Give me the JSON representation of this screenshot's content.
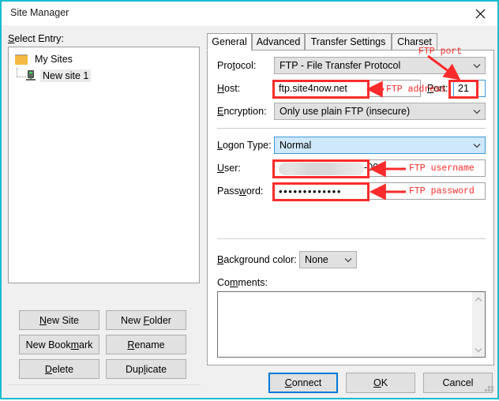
{
  "window": {
    "title": "Site Manager",
    "close_icon": "close-icon",
    "border_color": "#18bcd0"
  },
  "left_pane": {
    "select_entry_label": "Select Entry:",
    "tree": [
      {
        "label": "My Sites",
        "icon": "folder-icon",
        "selected": false
      },
      {
        "label": "New site 1",
        "icon": "server-icon",
        "selected": true
      }
    ],
    "buttons": [
      {
        "label": "New Site",
        "accel_index": 1
      },
      {
        "label": "New Folder",
        "accel_index": 4
      },
      {
        "label": "New Bookmark",
        "accel_index": 8
      },
      {
        "label": "Rename",
        "accel_index": 0
      },
      {
        "label": "Delete",
        "accel_index": 0
      },
      {
        "label": "Duplicate",
        "accel_index": 5
      }
    ]
  },
  "tabs": [
    {
      "label": "General",
      "active": true
    },
    {
      "label": "Advanced",
      "active": false
    },
    {
      "label": "Transfer Settings",
      "active": false
    },
    {
      "label": "Charset",
      "active": false
    }
  ],
  "general_tab": {
    "protocol": {
      "label": "Protocol:",
      "value": "FTP - File Transfer Protocol",
      "arrow_icon": "chevron-down-icon"
    },
    "host": {
      "label": "Host:",
      "value": "ftp.site4now.net"
    },
    "port": {
      "label": "Port:",
      "value": "21"
    },
    "encryption": {
      "label": "Encryption:",
      "value": "Only use plain FTP (insecure)",
      "arrow_icon": "chevron-down-icon"
    },
    "logon_type": {
      "label": "Logon Type:",
      "value": "Normal",
      "arrow_icon": "chevron-down-icon"
    },
    "user": {
      "label": "User:",
      "value_visible_suffix": "-001",
      "redacted": true
    },
    "password": {
      "label": "Password:",
      "masked_value": "•••••••••••••",
      "dot_count": 13
    },
    "background_color": {
      "label": "Background color:",
      "value": "None",
      "arrow_icon": "chevron-down-icon"
    },
    "comments": {
      "label": "Comments:",
      "value": "",
      "scroll_up_icon": "chevron-up-icon",
      "scroll_down_icon": "chevron-down-icon"
    }
  },
  "dialog_buttons": [
    {
      "label": "Connect",
      "default": true
    },
    {
      "label": "OK",
      "default": false
    },
    {
      "label": "Cancel",
      "default": false
    }
  ],
  "annotations": {
    "color": "#fb2b2b",
    "labels": {
      "port": "FTP port",
      "address": "FTP address",
      "username": "FTP username",
      "password": "FTP password"
    }
  }
}
